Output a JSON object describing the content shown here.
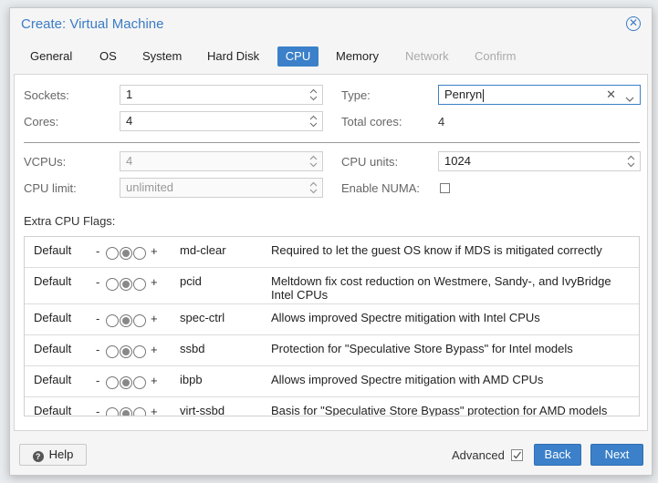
{
  "window": {
    "title": "Create: Virtual Machine"
  },
  "tabs": [
    {
      "label": "General",
      "state": "normal"
    },
    {
      "label": "OS",
      "state": "normal"
    },
    {
      "label": "System",
      "state": "normal"
    },
    {
      "label": "Hard Disk",
      "state": "normal"
    },
    {
      "label": "CPU",
      "state": "active"
    },
    {
      "label": "Memory",
      "state": "normal"
    },
    {
      "label": "Network",
      "state": "disabled"
    },
    {
      "label": "Confirm",
      "state": "disabled"
    }
  ],
  "form": {
    "sockets": {
      "label": "Sockets:",
      "value": "1"
    },
    "cores": {
      "label": "Cores:",
      "value": "4"
    },
    "type": {
      "label": "Type:",
      "value": "Penryn"
    },
    "total_cores": {
      "label": "Total cores:",
      "value": "4"
    },
    "vcpus": {
      "label": "VCPUs:",
      "value": "4"
    },
    "cpu_limit": {
      "label": "CPU limit:",
      "value": "unlimited"
    },
    "cpu_units": {
      "label": "CPU units:",
      "value": "1024"
    },
    "enable_numa": {
      "label": "Enable NUMA:",
      "checked": false
    }
  },
  "flags": {
    "label": "Extra CPU Flags:",
    "rows": [
      {
        "state": "Default",
        "minus": "-",
        "plus": "+",
        "name": "md-clear",
        "desc": "Required to let the guest OS know if MDS is mitigated correctly"
      },
      {
        "state": "Default",
        "minus": "-",
        "plus": "+",
        "name": "pcid",
        "desc": "Meltdown fix cost reduction on Westmere, Sandy-, and IvyBridge Intel CPUs"
      },
      {
        "state": "Default",
        "minus": "-",
        "plus": "+",
        "name": "spec-ctrl",
        "desc": "Allows improved Spectre mitigation with Intel CPUs"
      },
      {
        "state": "Default",
        "minus": "-",
        "plus": "+",
        "name": "ssbd",
        "desc": "Protection for \"Speculative Store Bypass\" for Intel models"
      },
      {
        "state": "Default",
        "minus": "-",
        "plus": "+",
        "name": "ibpb",
        "desc": "Allows improved Spectre mitigation with AMD CPUs"
      },
      {
        "state": "Default",
        "minus": "-",
        "plus": "+",
        "name": "virt-ssbd",
        "desc": "Basis for \"Speculative Store Bypass\" protection for AMD models"
      }
    ]
  },
  "footer": {
    "help": "Help",
    "advanced": "Advanced",
    "advanced_checked": true,
    "back": "Back",
    "next": "Next"
  },
  "colors": {
    "accent": "#3b80c9",
    "title": "#3b7cc6"
  }
}
